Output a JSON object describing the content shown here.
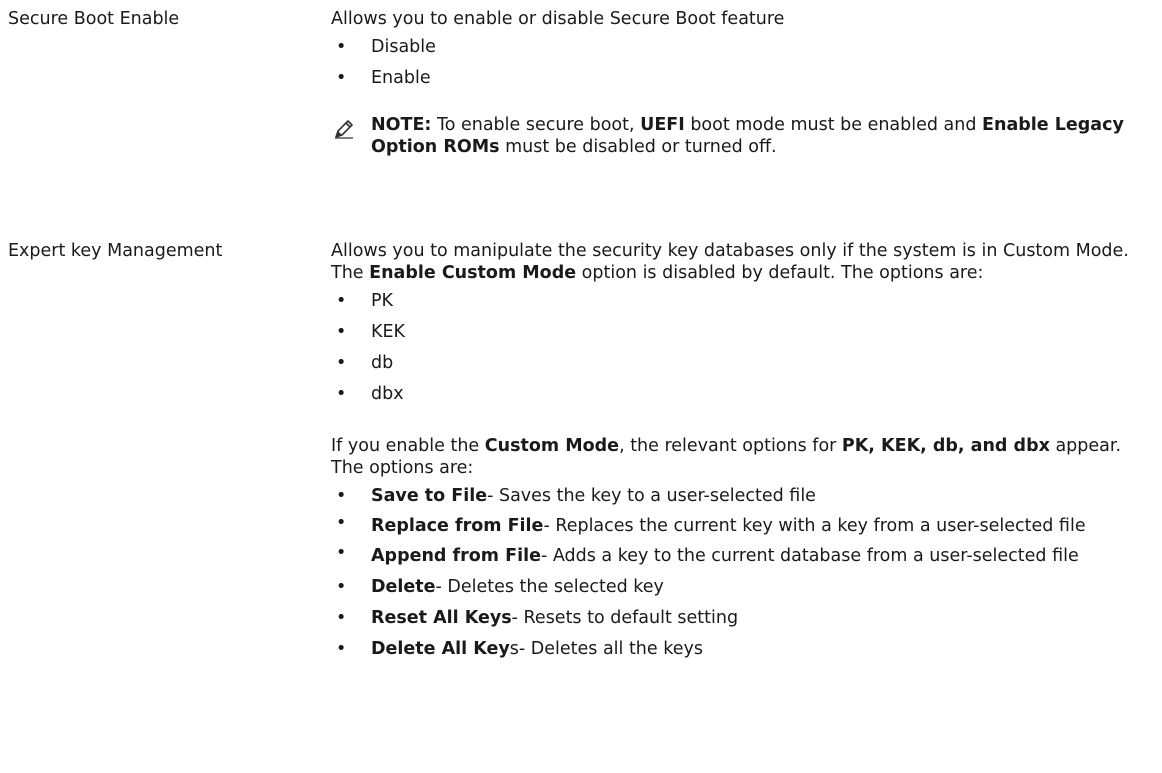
{
  "sections": [
    {
      "term": "Secure Boot Enable",
      "intro": "Allows you to enable or disable Secure Boot feature",
      "options": [
        "Disable",
        "Enable"
      ],
      "note": {
        "label": "NOTE:",
        "t1": " To enable secure boot, ",
        "b1": "UEFI",
        "t2": " boot mode must be enabled and ",
        "b2": "Enable Legacy Option ROMs",
        "t3": " must be disabled or turned off."
      }
    },
    {
      "term": "Expert key Management",
      "intro": {
        "t1": "Allows you to manipulate the security key databases only if the system is in Custom Mode. The ",
        "b1": "Enable Custom Mode",
        "t2": " option is disabled by default. The options are:"
      },
      "options": [
        "PK",
        "KEK",
        "db",
        "dbx"
      ],
      "custom": {
        "t1": "If you enable the ",
        "b1": "Custom Mode",
        "t2": ", the relevant options for ",
        "b2": "PK, KEK, db, and dbx",
        "t3": " appear. The options are:"
      },
      "custom_options": [
        {
          "bold": "Save to File",
          "text": "- Saves the key to a user-selected file"
        },
        {
          "bold": "Replace from File",
          "text": "- Replaces the current key with a key from a user-selected file"
        },
        {
          "bold": "Append from File",
          "text": "- Adds a key to the current database from a user-selected file"
        },
        {
          "bold": "Delete",
          "text": "- Deletes the selected key"
        },
        {
          "bold": "Reset All Keys",
          "text": "- Resets to default setting"
        },
        {
          "bold": "Delete All Key",
          "text": "s- Deletes all the keys"
        }
      ]
    }
  ]
}
